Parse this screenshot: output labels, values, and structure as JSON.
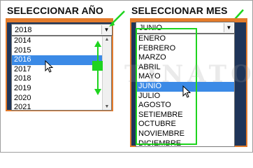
{
  "year_section": {
    "title": "SELECCIONAR AÑO",
    "selected_value": "2018",
    "options": [
      "2014",
      "2015",
      "2016",
      "2017",
      "2018",
      "2019",
      "2020",
      "2021"
    ],
    "highlighted_index": 2
  },
  "month_section": {
    "title": "SELECCIONAR MES",
    "selected_value": "JUNIO",
    "options": [
      "ENERO",
      "FEBRERO",
      "MARZO",
      "ABRIL",
      "MAYO",
      "JUNIO",
      "JULIO",
      "AGOSTO",
      "SETIEMBRE",
      "OCTUBRE",
      "NOVIEMBRE",
      "DICIEMBRE"
    ],
    "highlighted_index": 5
  },
  "watermark": "TINATO",
  "colors": {
    "panel": "#1f3559",
    "panel_border": "#e37b2b",
    "highlight": "#3b8ae6",
    "annotation_green": "#1ed41e"
  }
}
